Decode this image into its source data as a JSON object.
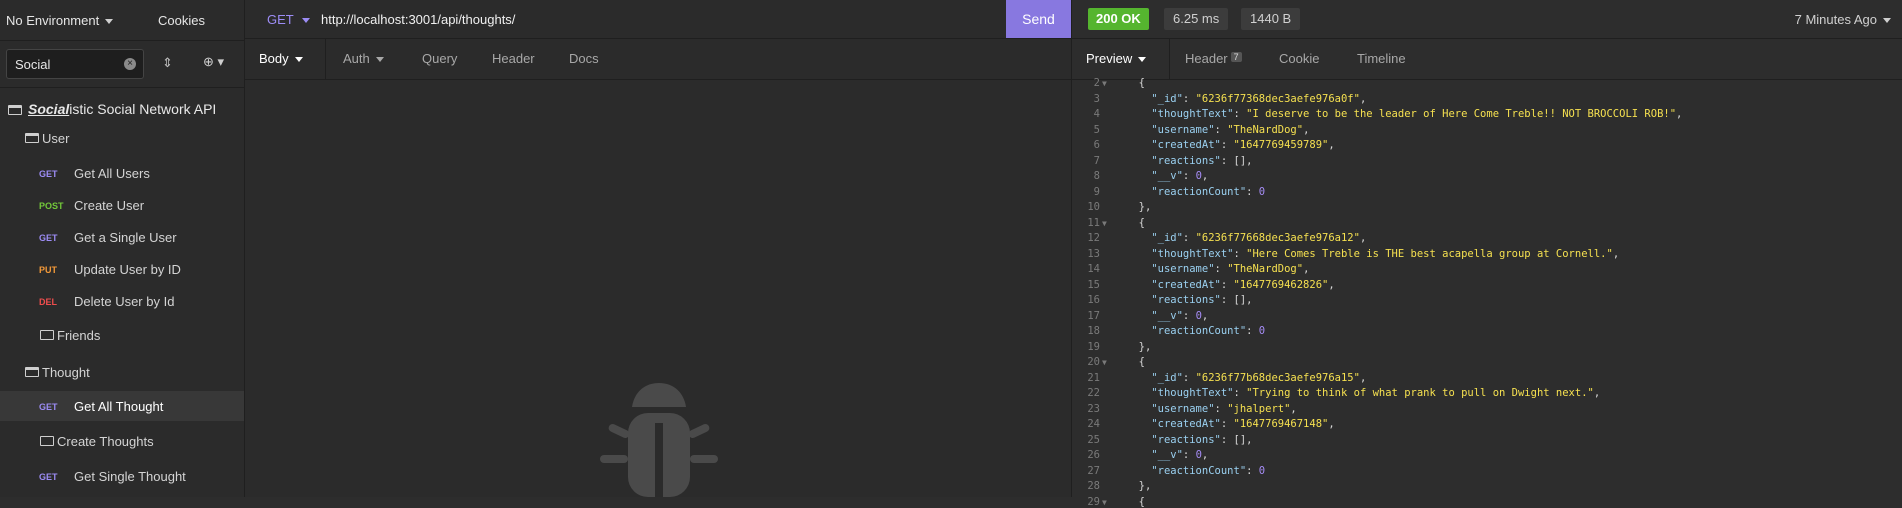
{
  "sidebar": {
    "environment": "No Environment",
    "cookies": "Cookies",
    "filter_value": "Social",
    "workspace_bold": "Social",
    "workspace_rest": "istic Social Network API",
    "items": [
      {
        "kind": "folder",
        "label": "User"
      },
      {
        "kind": "request",
        "method": "GET",
        "label": "Get All Users"
      },
      {
        "kind": "request",
        "method": "POST",
        "label": "Create User"
      },
      {
        "kind": "request",
        "method": "GET",
        "label": "Get a Single User"
      },
      {
        "kind": "request",
        "method": "PUT",
        "label": "Update User by ID"
      },
      {
        "kind": "request",
        "method": "DEL",
        "label": "Delete User by Id"
      },
      {
        "kind": "subfolder",
        "label": "Friends"
      },
      {
        "kind": "folder",
        "label": "Thought"
      },
      {
        "kind": "request",
        "method": "GET",
        "label": "Get All Thought",
        "active": true
      },
      {
        "kind": "subfolder",
        "label": "Create Thoughts"
      },
      {
        "kind": "request",
        "method": "GET",
        "label": "Get Single Thought"
      }
    ]
  },
  "request": {
    "method": "GET",
    "url": "http://localhost:3001/api/thoughts/",
    "send_label": "Send",
    "tabs": [
      "Body",
      "Auth",
      "Query",
      "Header",
      "Docs"
    ]
  },
  "response": {
    "status": "200 OK",
    "time": "6.25 ms",
    "size": "1440 B",
    "when": "7 Minutes Ago",
    "tabs": {
      "preview": "Preview",
      "header": "Header",
      "header_count": "7",
      "cookie": "Cookie",
      "timeline": "Timeline"
    },
    "lines": [
      {
        "n": "2",
        "fold": true,
        "t": "  {"
      },
      {
        "n": "3",
        "key": "_id",
        "val": "6236f77368dec3aefe976a0f",
        "type": "s"
      },
      {
        "n": "4",
        "key": "thoughtText",
        "val": "I deserve to be the leader of Here Come Treble!! NOT BROCCOLI ROB!",
        "type": "s"
      },
      {
        "n": "5",
        "key": "username",
        "val": "TheNardDog",
        "type": "s"
      },
      {
        "n": "6",
        "key": "createdAt",
        "val": "1647769459789",
        "type": "s"
      },
      {
        "n": "7",
        "key": "reactions",
        "val": "[]",
        "type": "p"
      },
      {
        "n": "8",
        "key": "__v",
        "val": "0",
        "type": "n"
      },
      {
        "n": "9",
        "key": "reactionCount",
        "val": "0",
        "type": "n",
        "last": true
      },
      {
        "n": "10",
        "t": "  },"
      },
      {
        "n": "11",
        "fold": true,
        "t": "  {"
      },
      {
        "n": "12",
        "key": "_id",
        "val": "6236f77668dec3aefe976a12",
        "type": "s"
      },
      {
        "n": "13",
        "key": "thoughtText",
        "val": "Here Comes Treble is THE best acapella group at Cornell.",
        "type": "s"
      },
      {
        "n": "14",
        "key": "username",
        "val": "TheNardDog",
        "type": "s"
      },
      {
        "n": "15",
        "key": "createdAt",
        "val": "1647769462826",
        "type": "s"
      },
      {
        "n": "16",
        "key": "reactions",
        "val": "[]",
        "type": "p"
      },
      {
        "n": "17",
        "key": "__v",
        "val": "0",
        "type": "n"
      },
      {
        "n": "18",
        "key": "reactionCount",
        "val": "0",
        "type": "n",
        "last": true
      },
      {
        "n": "19",
        "t": "  },"
      },
      {
        "n": "20",
        "fold": true,
        "t": "  {"
      },
      {
        "n": "21",
        "key": "_id",
        "val": "6236f77b68dec3aefe976a15",
        "type": "s"
      },
      {
        "n": "22",
        "key": "thoughtText",
        "val": "Trying to think of what prank to pull on Dwight next.",
        "type": "s"
      },
      {
        "n": "23",
        "key": "username",
        "val": "jhalpert",
        "type": "s"
      },
      {
        "n": "24",
        "key": "createdAt",
        "val": "1647769467148",
        "type": "s"
      },
      {
        "n": "25",
        "key": "reactions",
        "val": "[]",
        "type": "p"
      },
      {
        "n": "26",
        "key": "__v",
        "val": "0",
        "type": "n"
      },
      {
        "n": "27",
        "key": "reactionCount",
        "val": "0",
        "type": "n",
        "last": true
      },
      {
        "n": "28",
        "t": "  },"
      },
      {
        "n": "29",
        "fold": true,
        "t": "  {"
      }
    ]
  },
  "colors": {
    "accent": "#8878e0",
    "ok": "#55b52f",
    "get": "#9c8cf5",
    "post": "#73c93a",
    "put": "#f59a38",
    "del": "#ef4d4d"
  }
}
